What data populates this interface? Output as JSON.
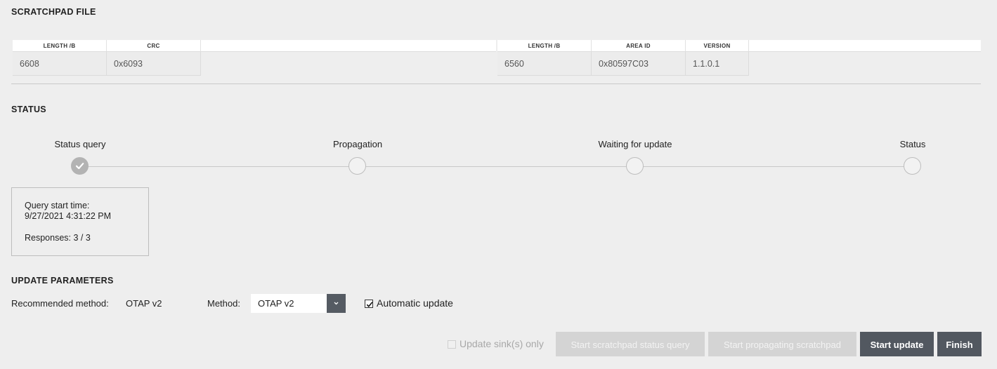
{
  "scratchpad": {
    "title": "SCRATCHPAD FILE",
    "left_table": {
      "headers": [
        "LENGTH /B",
        "CRC"
      ],
      "values": [
        "6608",
        "0x6093"
      ]
    },
    "right_table": {
      "headers": [
        "LENGTH /B",
        "AREA ID",
        "VERSION"
      ],
      "values": [
        "6560",
        "0x80597C03",
        "1.1.0.1"
      ]
    }
  },
  "status": {
    "title": "STATUS",
    "steps": [
      {
        "label": "Status query",
        "done": true
      },
      {
        "label": "Propagation",
        "done": false
      },
      {
        "label": "Waiting for update",
        "done": false
      },
      {
        "label": "Status",
        "done": false
      }
    ],
    "info": {
      "query_start_label": "Query start time:",
      "query_start_value": "9/27/2021 4:31:22 PM",
      "responses": "Responses: 3 / 3"
    }
  },
  "update_parameters": {
    "title": "UPDATE PARAMETERS",
    "recommended_label": "Recommended method:",
    "recommended_value": "OTAP v2",
    "method_label": "Method:",
    "method_value": "OTAP v2",
    "automatic_update_label": "Automatic update",
    "automatic_update_checked": true,
    "sink_only_label": "Update sink(s) only",
    "sink_only_checked": false
  },
  "actions": {
    "start_status_query": "Start scratchpad status query",
    "start_propagating": "Start propagating scratchpad",
    "start_update": "Start update",
    "finish": "Finish"
  },
  "icons": {
    "check": "check-icon",
    "dropdown": "chevron-down-icon"
  },
  "colors": {
    "background": "#eeeeee",
    "primary_button": "#525860",
    "disabled_button": "#d4d4d4",
    "step_done": "#b3b3b3"
  }
}
